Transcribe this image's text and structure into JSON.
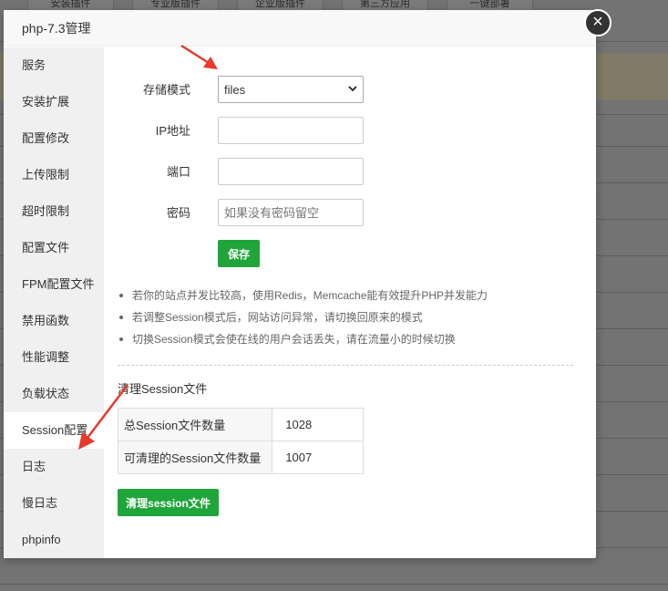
{
  "background": {
    "tabs": [
      "安装插件",
      "专业版插件",
      "企业版插件",
      "第三方应用",
      "一键部署"
    ]
  },
  "modal": {
    "title": "php-7.3管理",
    "close_symbol": "×"
  },
  "sidebar": {
    "items": [
      {
        "label": "服务"
      },
      {
        "label": "安装扩展"
      },
      {
        "label": "配置修改"
      },
      {
        "label": "上传限制"
      },
      {
        "label": "超时限制"
      },
      {
        "label": "配置文件"
      },
      {
        "label": "FPM配置文件"
      },
      {
        "label": "禁用函数"
      },
      {
        "label": "性能调整"
      },
      {
        "label": "负载状态"
      },
      {
        "label": "Session配置",
        "active": true
      },
      {
        "label": "日志"
      },
      {
        "label": "慢日志"
      },
      {
        "label": "phpinfo"
      }
    ]
  },
  "form": {
    "storage_mode_label": "存储模式",
    "storage_mode_value": "files",
    "ip_label": "IP地址",
    "ip_value": "",
    "port_label": "端口",
    "port_value": "",
    "password_label": "密码",
    "password_placeholder": "如果没有密码留空",
    "save_label": "保存"
  },
  "tips": [
    "若你的站点并发比较高，使用Redis，Memcache能有效提升PHP并发能力",
    "若调整Session模式后，网站访问异常，请切换回原来的模式",
    "切换Session模式会使在线的用户会话丢失，请在流量小的时候切换"
  ],
  "cleanup": {
    "title": "清理Session文件",
    "total_label": "总Session文件数量",
    "total_value": "1028",
    "cleanable_label": "可清理的Session文件数量",
    "cleanable_value": "1007",
    "button_label": "清理session文件"
  },
  "colors": {
    "accent": "#20a53a",
    "annotation_arrow": "#e8392b"
  }
}
